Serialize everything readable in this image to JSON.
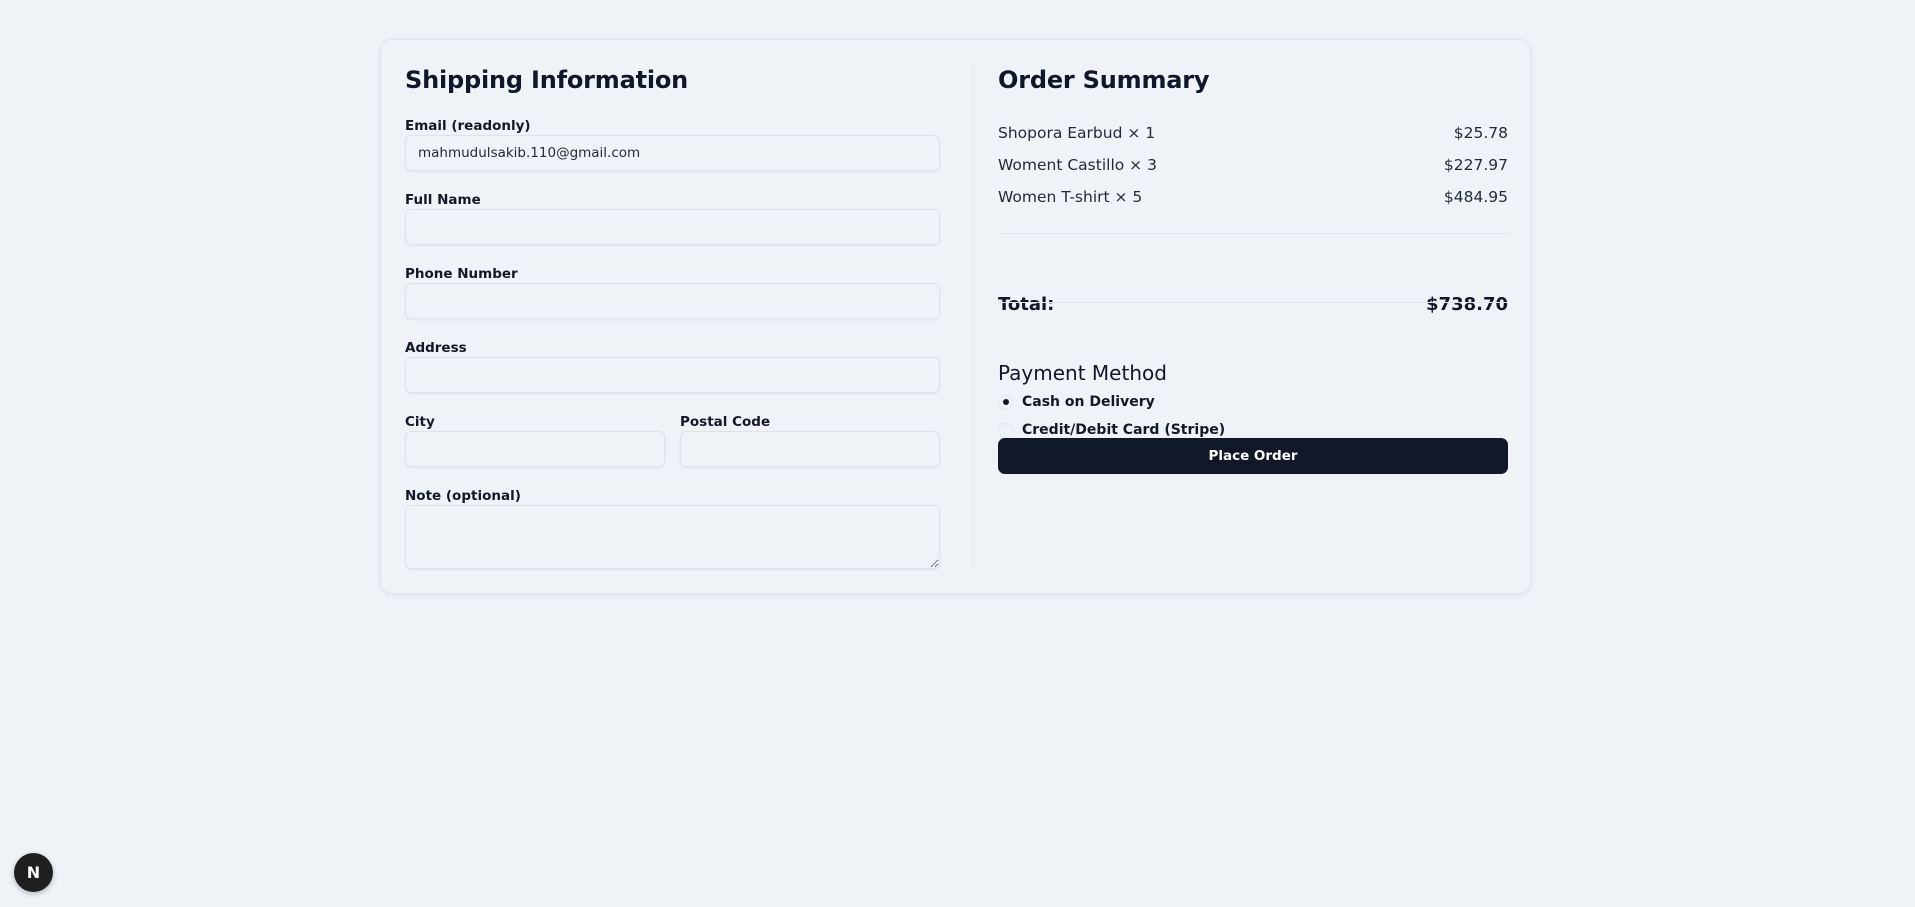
{
  "shipping": {
    "title": "Shipping Information",
    "email": {
      "label": "Email (readonly)",
      "value": "mahmudulsakib.110@gmail.com"
    },
    "full_name": {
      "label": "Full Name",
      "value": ""
    },
    "phone": {
      "label": "Phone Number",
      "value": ""
    },
    "address": {
      "label": "Address",
      "value": ""
    },
    "city": {
      "label": "City",
      "value": ""
    },
    "postal_code": {
      "label": "Postal Code",
      "value": ""
    },
    "note": {
      "label": "Note (optional)",
      "value": ""
    }
  },
  "summary": {
    "title": "Order Summary",
    "items": [
      {
        "name": "Shopora Earbud × 1",
        "price": "$25.78"
      },
      {
        "name": "Woment Castillo × 3",
        "price": "$227.97"
      },
      {
        "name": "Women T-shirt × 5",
        "price": "$484.95"
      }
    ],
    "total_label": "Total:",
    "total_value": "$738.70"
  },
  "payment": {
    "title": "Payment Method",
    "options": [
      {
        "label": "Cash on Delivery",
        "selected": true
      },
      {
        "label": "Credit/Debit Card (Stripe)",
        "selected": false
      }
    ],
    "place_order_label": "Place Order"
  },
  "dev_badge": {
    "letter": "N"
  },
  "colors": {
    "background": "#eff3f8",
    "primary_button": "#111827",
    "text": "#0f172a"
  }
}
